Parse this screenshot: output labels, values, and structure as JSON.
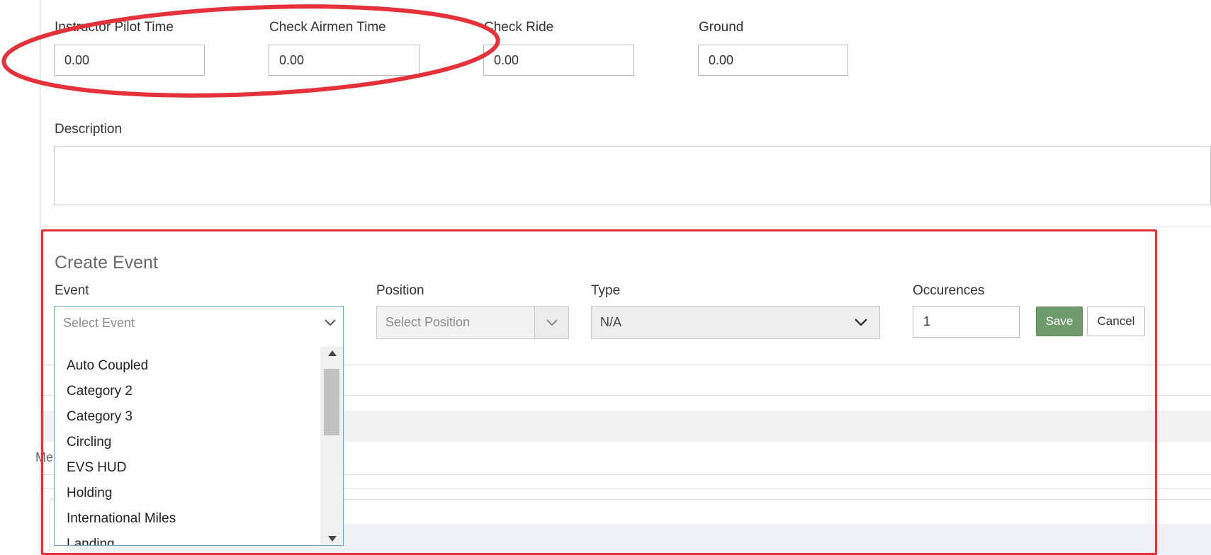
{
  "time_fields": {
    "instructor_pilot": {
      "label": "Instructor Pilot Time",
      "value": "0.00"
    },
    "check_airmen": {
      "label": "Check Airmen Time",
      "value": "0.00"
    },
    "check_ride": {
      "label": "Check Ride",
      "value": "0.00"
    },
    "ground": {
      "label": "Ground",
      "value": "0.00"
    }
  },
  "description": {
    "label": "Description",
    "value": ""
  },
  "create_event": {
    "title": "Create Event",
    "event": {
      "label": "Event",
      "placeholder": "Select Event"
    },
    "position": {
      "label": "Position",
      "placeholder": "Select Position"
    },
    "type": {
      "label": "Type",
      "value": "N/A"
    },
    "occurences": {
      "label": "Occurences",
      "value": "1"
    },
    "save_label": "Save",
    "cancel_label": "Cancel"
  },
  "event_options": [
    "Auto Coupled",
    "Category 2",
    "Category 3",
    "Circling",
    "EVS HUD",
    "Holding",
    "International Miles",
    "Landing"
  ],
  "background_fragment": "Me",
  "annotation_colors": {
    "highlight": "#e5323a",
    "accent_blue": "#6fa0d6",
    "save_green": "#6f9a6c"
  }
}
